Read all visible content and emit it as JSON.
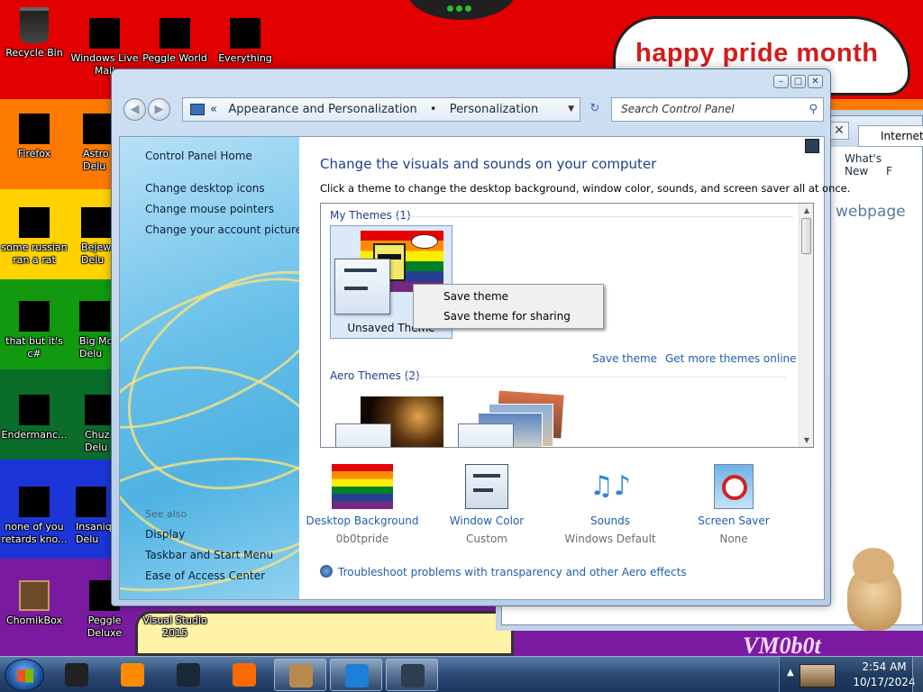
{
  "wallpaper": {
    "banner_text": "happy pride month",
    "corner_tag": "VM0b0t"
  },
  "desktop": {
    "icons": [
      {
        "label": "Recycle Bin"
      },
      {
        "label": "Windows Live Mail"
      },
      {
        "label": "Peggle World"
      },
      {
        "label": "Everything"
      },
      {
        "label": "Firefox"
      },
      {
        "label": "Astro Delu"
      },
      {
        "label": "some russian ran a rat"
      },
      {
        "label": "Bejew Delu"
      },
      {
        "label": "that but it's c#"
      },
      {
        "label": "Big Mo Delu"
      },
      {
        "label": "Endermanc..."
      },
      {
        "label": "Chuz Delu"
      },
      {
        "label": "none of you retards kno..."
      },
      {
        "label": "Insaniq Delu"
      },
      {
        "label": "ChomikBox"
      },
      {
        "label": "Peggle Deluxe"
      },
      {
        "label": "Visual Studio 2015"
      }
    ]
  },
  "ie_window": {
    "tab_label": "Internet E",
    "menu": [
      "What's New",
      "F"
    ],
    "content_text": "webpage"
  },
  "window": {
    "caption_buttons": [
      "minimize",
      "maximize",
      "close"
    ],
    "breadcrumb": {
      "chevron": "«",
      "items": [
        "Appearance and Personalization",
        "Personalization"
      ],
      "separator": "•"
    },
    "search_placeholder": "Search Control Panel",
    "sidebar": {
      "home": "Control Panel Home",
      "links": [
        "Change desktop icons",
        "Change mouse pointers",
        "Change your account picture"
      ],
      "see_also_title": "See also",
      "see_also": [
        "Display",
        "Taskbar and Start Menu",
        "Ease of Access Center"
      ]
    },
    "main": {
      "title": "Change the visuals and sounds on your computer",
      "subtitle": "Click a theme to change the desktop background, window color, sounds, and screen saver all at once.",
      "my_themes_header": "My Themes (1)",
      "unsaved_theme": "Unsaved Theme",
      "context_menu": [
        "Save theme",
        "Save theme for sharing"
      ],
      "save_theme_link": "Save theme",
      "more_themes_link": "Get more themes online",
      "aero_header": "Aero Themes (2)",
      "bottom": [
        {
          "label": "Desktop Background",
          "value": "0b0tpride",
          "icon": "desktop-background-icon"
        },
        {
          "label": "Window Color",
          "value": "Custom",
          "icon": "window-color-icon"
        },
        {
          "label": "Sounds",
          "value": "Windows Default",
          "icon": "sounds-icon"
        },
        {
          "label": "Screen Saver",
          "value": "None",
          "icon": "screen-saver-icon"
        }
      ],
      "troubleshoot": "Troubleshoot problems with transparency and other Aero effects"
    }
  },
  "taskbar": {
    "time": "2:54 AM",
    "date": "10/17/2024",
    "buttons": [
      {
        "name": "cmd",
        "color": "#222222",
        "open": false
      },
      {
        "name": "media-player",
        "color": "#ff8a00",
        "open": false
      },
      {
        "name": "steam",
        "color": "#1b2838",
        "open": false
      },
      {
        "name": "firefox",
        "color": "#ff6a00",
        "open": false
      },
      {
        "name": "chomikbox",
        "color": "#b98a4e",
        "open": true
      },
      {
        "name": "internet-explorer",
        "color": "#1d7fd6",
        "open": true
      },
      {
        "name": "control-panel",
        "color": "#2c3e50",
        "open": true
      }
    ]
  }
}
